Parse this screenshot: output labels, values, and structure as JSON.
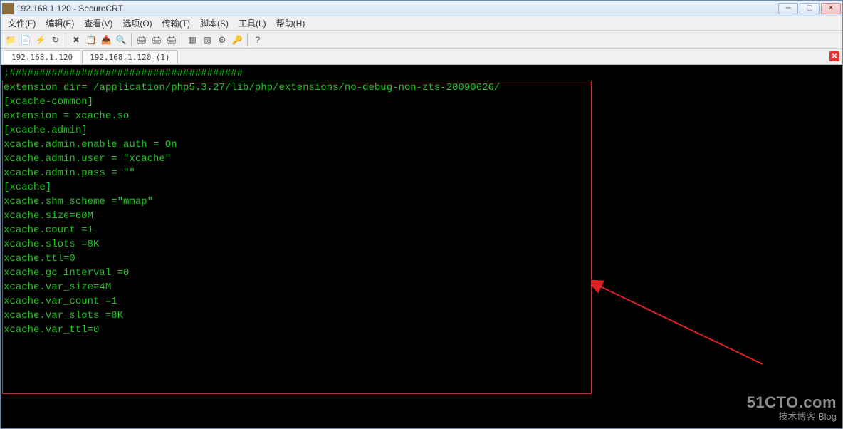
{
  "window": {
    "title": "192.168.1.120 - SecureCRT"
  },
  "menu": {
    "file": "文件(F)",
    "edit": "编辑(E)",
    "view": "查看(V)",
    "options": "选项(O)",
    "transfer": "传输(T)",
    "script": "脚本(S)",
    "tools": "工具(L)",
    "help": "帮助(H)"
  },
  "toolbar_icons": [
    "folder-icon",
    "sessions-icon",
    "quick-icon",
    "reconnect-icon",
    "disconnect-icon",
    "copy-icon",
    "paste-icon",
    "find-icon",
    "print-icon",
    "printer-icon",
    "printer2-icon",
    "tile-icon",
    "cascade-icon",
    "properties-icon",
    "key-icon",
    "help-icon"
  ],
  "tabs": [
    {
      "label": "192.168.1.120",
      "active": true
    },
    {
      "label": "192.168.1.120  (1)",
      "active": false
    }
  ],
  "terminal": {
    "lines": [
      ";#######################################",
      "extension_dir= /application/php5.3.27/lib/php/extensions/no-debug-non-zts-20090626/",
      "[xcache-common]",
      "extension = xcache.so",
      "",
      "[xcache.admin]",
      "",
      "xcache.admin.enable_auth = On",
      "xcache.admin.user = \"xcache\"",
      "xcache.admin.pass = \"\"",
      "",
      "[xcache]",
      "xcache.shm_scheme =\"mmap\"",
      "xcache.size=60M",
      "xcache.count =1",
      "xcache.slots =8K",
      "xcache.ttl=0",
      "xcache.gc_interval =0",
      "xcache.var_size=4M",
      "xcache.var_count =1",
      "xcache.var_slots =8K",
      "xcache.var_ttl=0"
    ]
  },
  "watermark": {
    "line1": "51CTO.com",
    "line2": "技术博客   Blog"
  }
}
